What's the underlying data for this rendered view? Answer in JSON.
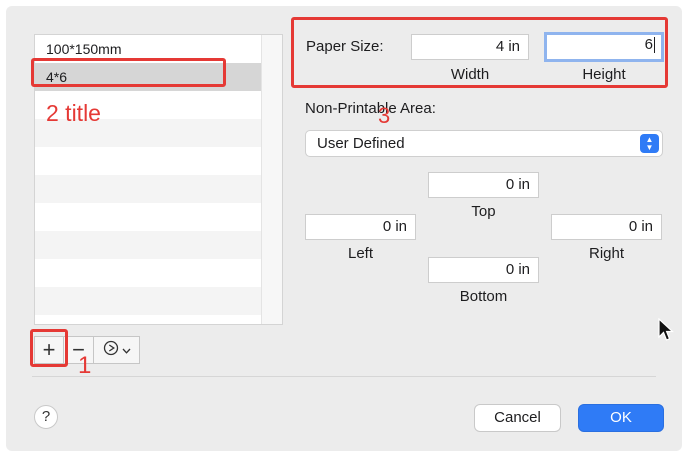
{
  "paper_list": {
    "items": [
      "100*150mm",
      "4*6"
    ],
    "selected_index": 1,
    "empty_rows": 8
  },
  "list_toolbar": {
    "add_label": "+",
    "remove_label": "−",
    "options_icon": "gear-options-icon"
  },
  "paper_size": {
    "label": "Paper Size:",
    "width_value": "4 in",
    "height_value": "6",
    "width_label": "Width",
    "height_label": "Height"
  },
  "non_printable": {
    "label": "Non-Printable Area:",
    "select_value": "User Defined",
    "top_value": "0 in",
    "left_value": "0 in",
    "right_value": "0 in",
    "bottom_value": "0 in",
    "top_label": "Top",
    "left_label": "Left",
    "right_label": "Right",
    "bottom_label": "Bottom"
  },
  "footer": {
    "help_label": "?",
    "cancel_label": "Cancel",
    "ok_label": "OK"
  },
  "annotations": {
    "label_1": "1",
    "label_2": "2 title",
    "label_3": "3",
    "color": "#e53935"
  },
  "colors": {
    "accent": "#2f7bf6",
    "focus_ring": "#8fb4ee",
    "dialog_bg": "#ececec"
  }
}
